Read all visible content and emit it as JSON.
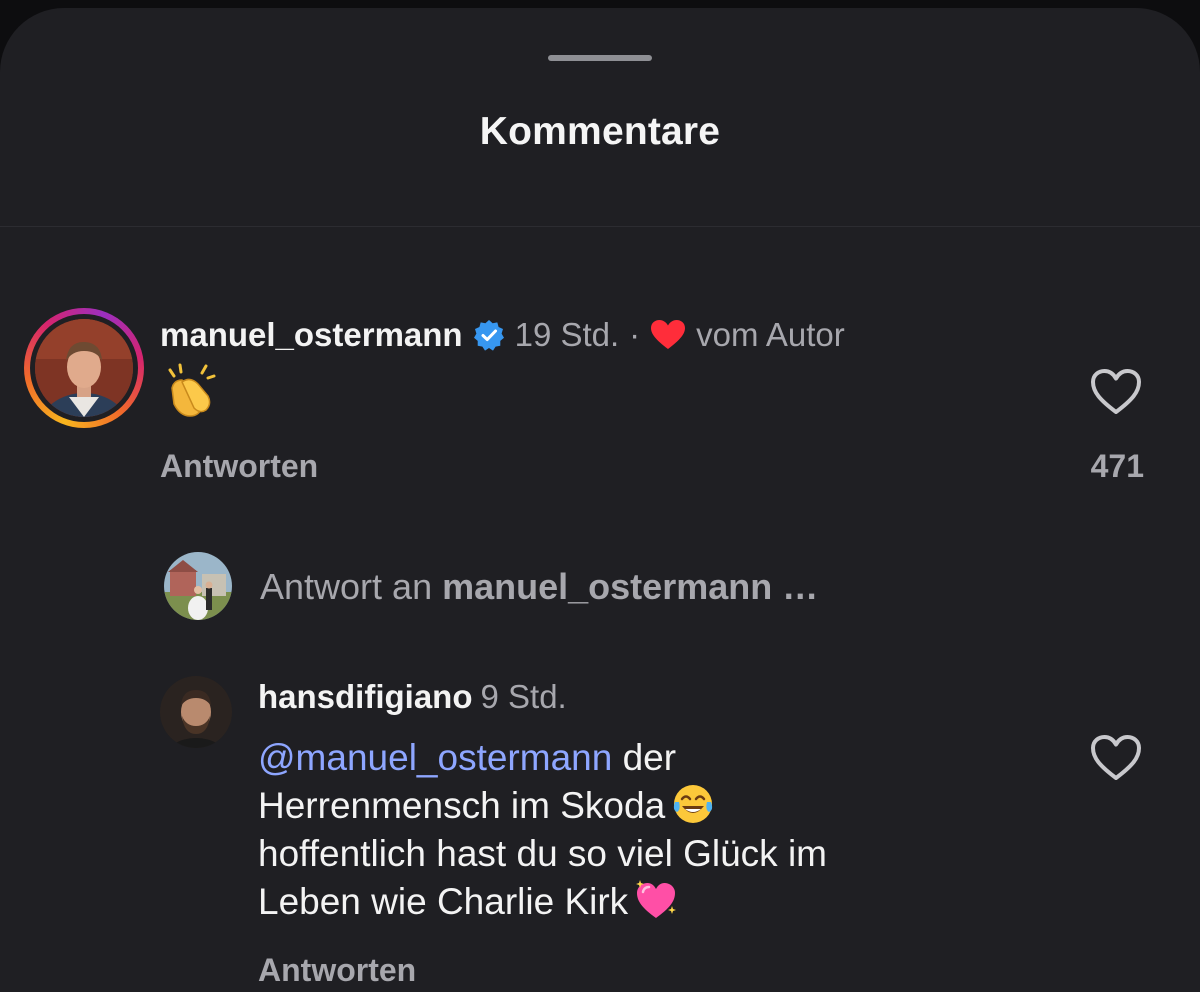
{
  "sheet": {
    "title": "Kommentare"
  },
  "comment_1": {
    "username": "manuel_ostermann",
    "verified": true,
    "time": "19 Std.",
    "separator": "·",
    "author_label": "vom Autor",
    "text_emoji": "clapping-hands-emoji",
    "reply_label": "Antworten",
    "like_count": "471"
  },
  "composer": {
    "prefix": "Antwort an",
    "target": "manuel_ostermann …"
  },
  "comment_2": {
    "username": "hansdifigiano",
    "time": "9 Std.",
    "mention": "@manuel_ostermann",
    "line1_rest": " der",
    "line2": "Herrenmensch im Skoda",
    "line3": "hoffentlich hast du so viel Glück im",
    "line4": "Leben wie Charlie Kirk",
    "emoji_1": "tears-of-joy-emoji",
    "emoji_2": "sparkling-heart-emoji",
    "reply_label": "Antworten"
  },
  "colors": {
    "background": "#1f1f23",
    "text_primary": "#f3f3f3",
    "text_secondary": "#a7a7ad",
    "mention": "#8ea6ff",
    "verified_blue": "#3797f0",
    "heart_red": "#ff2d3a"
  }
}
